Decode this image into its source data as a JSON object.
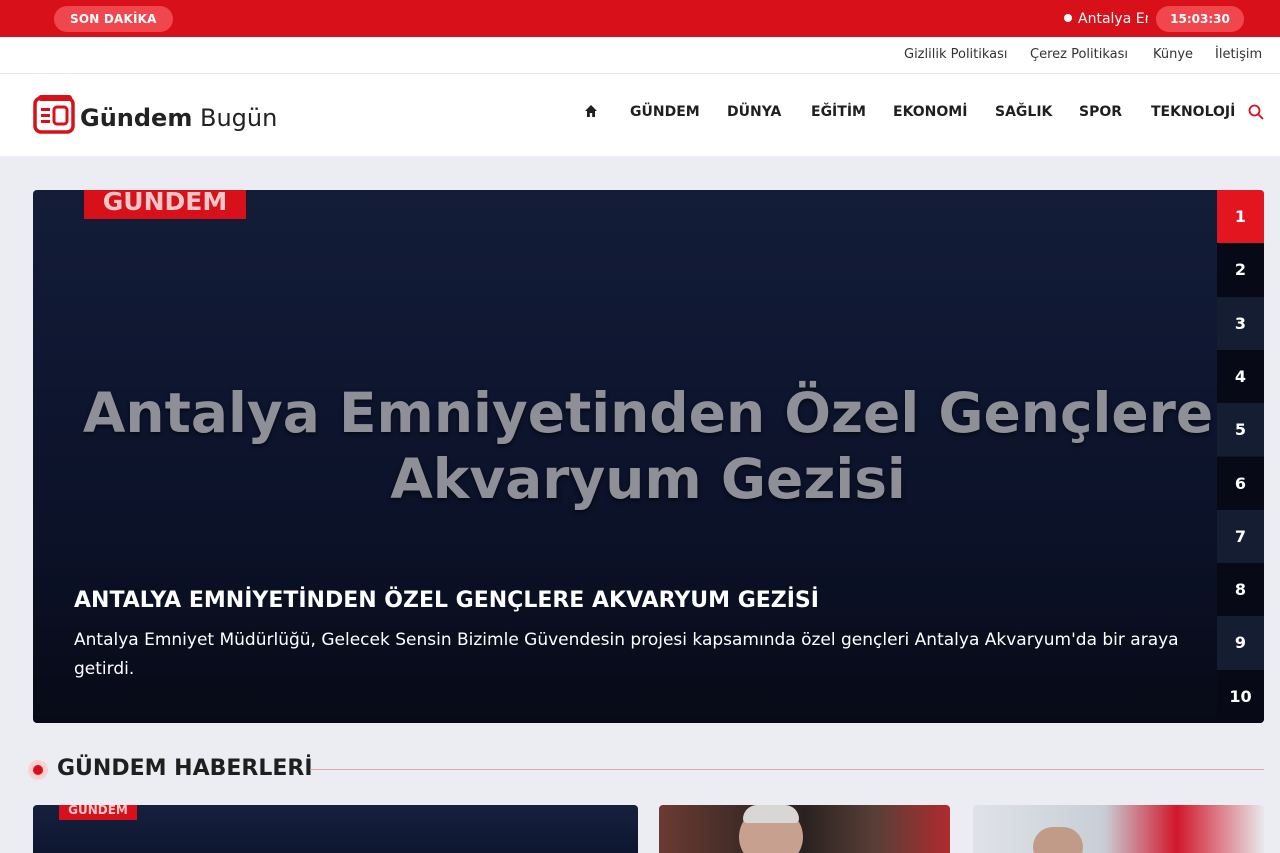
{
  "topbar": {
    "breaking_label": "SON DAKİKA",
    "ticker_text": "Antalya Emniyetinden Özel Gençlere Akvaryum Gezisi",
    "clock": "15:03:30"
  },
  "utility_links": [
    "Gizlilik Politikası",
    "Çerez Politikası",
    "Künye",
    "İletişim"
  ],
  "brand": {
    "name_bold": "Gündem",
    "name_light": "Bugün",
    "accent": "#d8101a"
  },
  "nav": {
    "home_icon": "home-icon",
    "items": [
      "GÜNDEM",
      "DÜNYA",
      "EĞİTİM",
      "EKONOMİ",
      "SAĞLIK",
      "SPOR",
      "TEKNOLOJİ"
    ],
    "search_icon": "search-icon"
  },
  "hero": {
    "category": "GÜNDEM",
    "image_text": "Antalya Emniyetinden Özel Gençlere Akvaryum Gezisi",
    "title": "ANTALYA EMNİYETİNDEN ÖZEL GENÇLERE AKVARYUM GEZİSİ",
    "description": "Antalya Emniyet Müdürlüğü, Gelecek Sensin Bizimle Güvendesin projesi kapsamında özel gençleri Antalya Akvaryum'da bir araya getirdi.",
    "pages": [
      "1",
      "2",
      "3",
      "4",
      "5",
      "6",
      "7",
      "8",
      "9",
      "10"
    ],
    "active_page": 1
  },
  "section": {
    "title": "GÜNDEM HABERLERİ"
  },
  "cards": [
    {
      "category": "GÜNDEM"
    }
  ]
}
